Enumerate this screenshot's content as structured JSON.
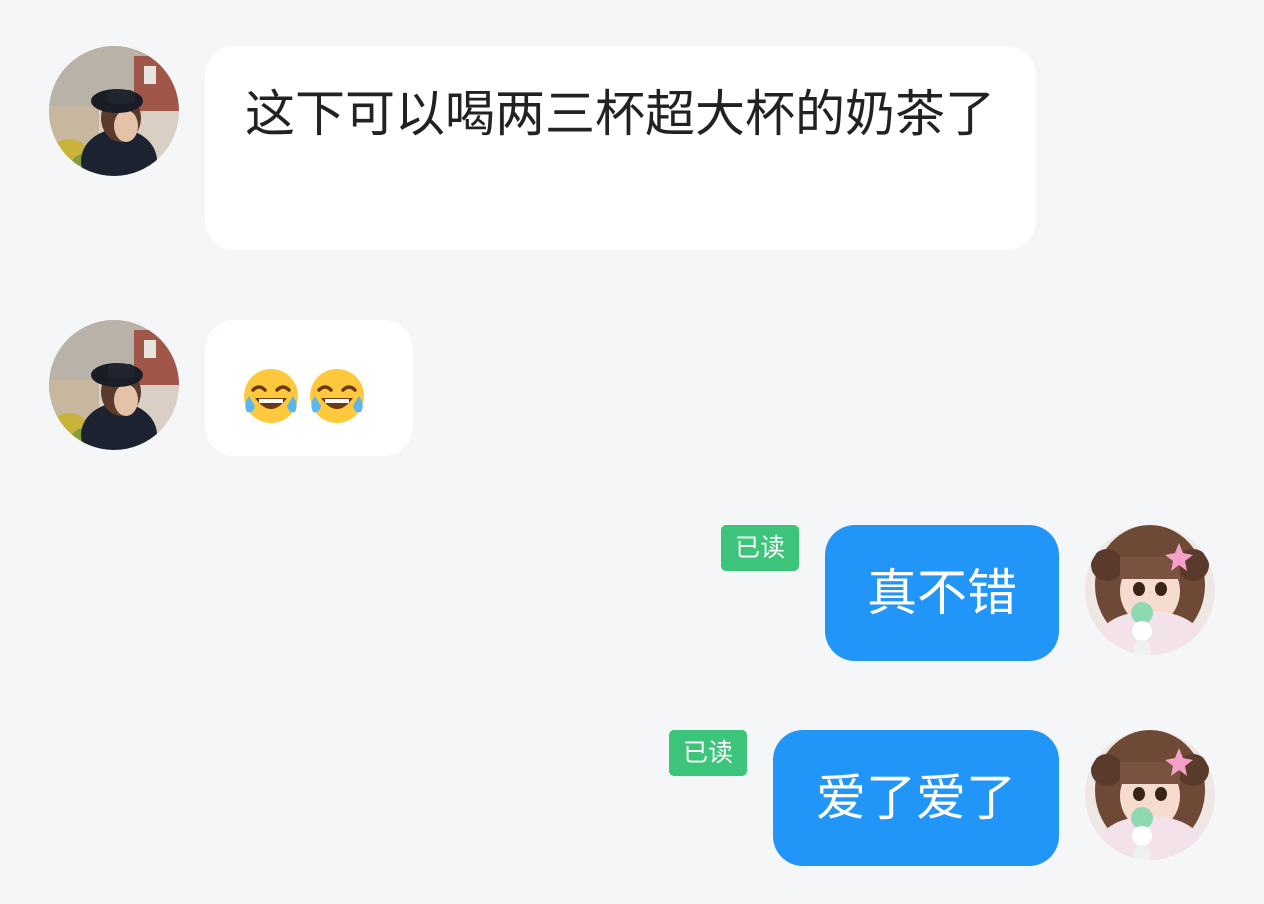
{
  "messages": [
    {
      "side": "in",
      "text": "这下可以喝两三杯超大杯的奶茶了"
    },
    {
      "side": "in",
      "emoji": [
        "face-with-tears-of-joy-icon",
        "face-with-tears-of-joy-icon"
      ]
    },
    {
      "side": "out",
      "text": "真不错",
      "status": "已读"
    },
    {
      "side": "out",
      "text": "爱了爱了",
      "status": "已读"
    }
  ],
  "colors": {
    "background": "#f5f6f8",
    "incoming_bubble": "#ffffff",
    "outgoing_bubble": "#2196f8",
    "read_badge": "#3cc57a"
  }
}
